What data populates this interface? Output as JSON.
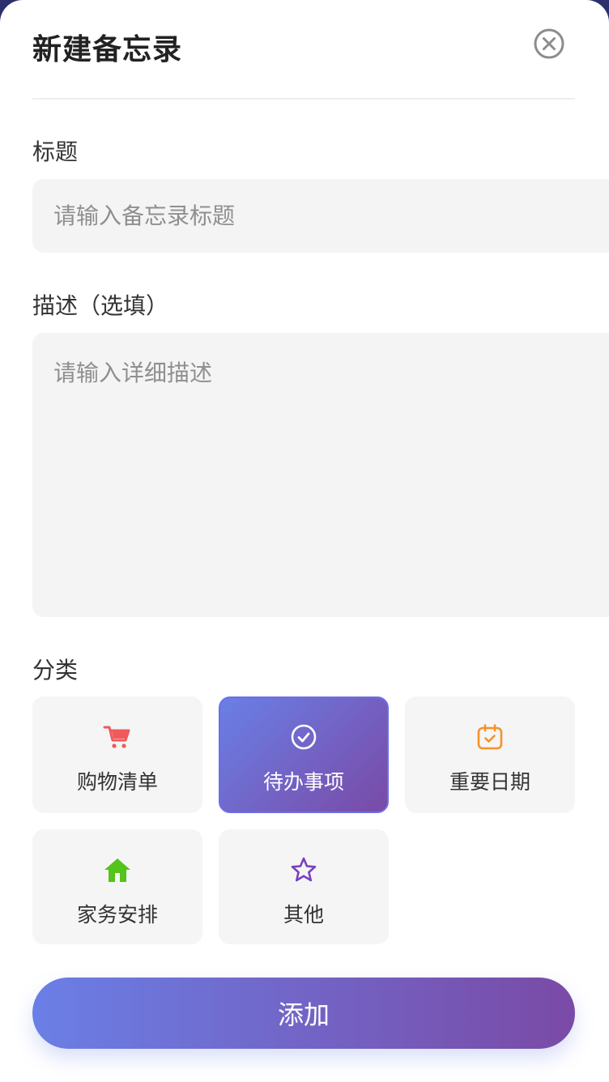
{
  "modal": {
    "title": "新建备忘录"
  },
  "form": {
    "title_label": "标题",
    "title_placeholder": "请输入备忘录标题",
    "title_value": "",
    "desc_label": "描述（选填）",
    "desc_placeholder": "请输入详细描述",
    "desc_value": "",
    "category_label": "分类"
  },
  "categories": [
    {
      "label": "购物清单",
      "icon": "cart-icon",
      "color": "#f05a5a",
      "selected": false
    },
    {
      "label": "待办事项",
      "icon": "check-circle-icon",
      "color": "#ffffff",
      "selected": true
    },
    {
      "label": "重要日期",
      "icon": "calendar-check-icon",
      "color": "#f5922a",
      "selected": false
    },
    {
      "label": "家务安排",
      "icon": "home-icon",
      "color": "#52c41a",
      "selected": false
    },
    {
      "label": "其他",
      "icon": "star-icon",
      "color": "#7a3fc0",
      "selected": false
    }
  ],
  "actions": {
    "submit_label": "添加"
  },
  "colors": {
    "accent_start": "#6a7fe6",
    "accent_end": "#7a4aa6"
  }
}
